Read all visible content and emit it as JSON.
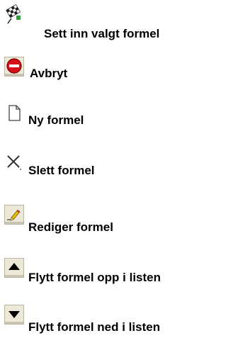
{
  "legend": {
    "items": [
      {
        "icon": "checkered-flag-icon",
        "label": "Sett inn valgt formel"
      },
      {
        "icon": "stop-icon",
        "label": "Avbryt"
      },
      {
        "icon": "new-document-icon",
        "label": "Ny formel"
      },
      {
        "icon": "delete-x-icon",
        "label": "Slett formel"
      },
      {
        "icon": "edit-pencil-icon",
        "label": "Rediger formel"
      },
      {
        "icon": "arrow-up-icon",
        "label": "Flytt formel opp i listen"
      },
      {
        "icon": "arrow-down-icon",
        "label": "Flytt formel ned i listen"
      }
    ]
  }
}
